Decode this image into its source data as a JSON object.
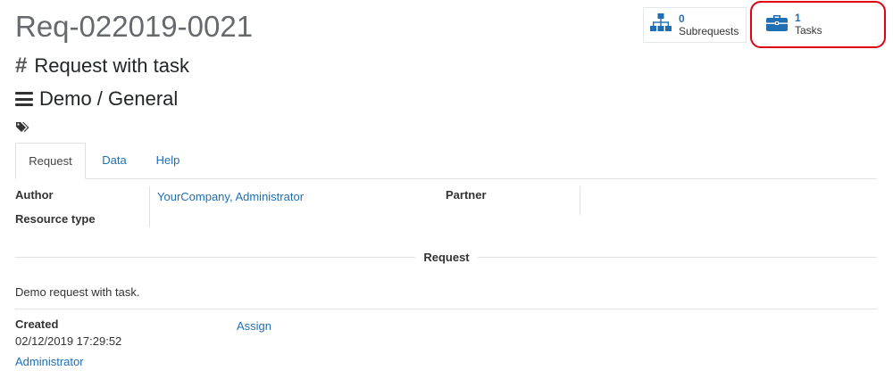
{
  "header": {
    "title": "Req-022019-0021",
    "name": "Request with task",
    "category_path": "Demo / General"
  },
  "smart_buttons": [
    {
      "count": "0",
      "label": "Subrequests",
      "icon": "sitemap-icon"
    },
    {
      "count": "1",
      "label": "Tasks",
      "icon": "briefcase-icon"
    }
  ],
  "tabs": [
    {
      "label": "Request",
      "active": true
    },
    {
      "label": "Data",
      "active": false
    },
    {
      "label": "Help",
      "active": false
    }
  ],
  "fields": {
    "author_label": "Author",
    "author_value": "YourCompany, Administrator",
    "resource_type_label": "Resource type",
    "partner_label": "Partner"
  },
  "section": {
    "title": "Request",
    "body": "Demo request with task."
  },
  "footer": {
    "created_label": "Created",
    "created_date": "02/12/2019 17:29:52",
    "created_by": "Administrator",
    "assign_label": "Assign"
  },
  "colors": {
    "link": "#1f6fb2",
    "icon": "#1f6fb2",
    "highlight": "#e0000f"
  }
}
